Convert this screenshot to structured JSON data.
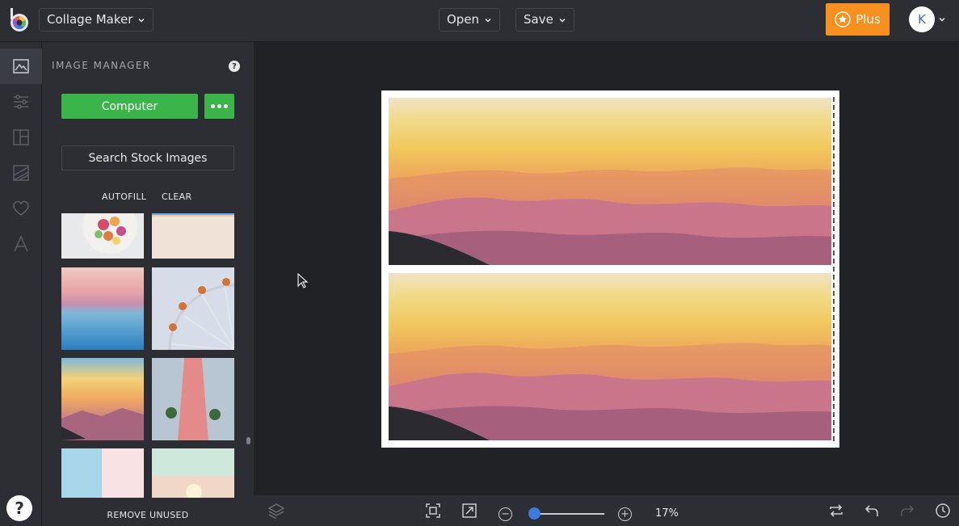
{
  "app": {
    "menu_label": "Collage Maker",
    "open_label": "Open",
    "save_label": "Save",
    "plus_label": "Plus",
    "avatar_initial": "K"
  },
  "colors": {
    "accent_green": "#3bb54a",
    "plus_orange": "#f7901e",
    "slider_blue": "#3b7ddd"
  },
  "rail": {
    "items": [
      {
        "icon": "image-icon",
        "active": true
      },
      {
        "icon": "adjust-sliders-icon"
      },
      {
        "icon": "layout-icon"
      },
      {
        "icon": "background-icon"
      },
      {
        "icon": "heart-icon"
      },
      {
        "icon": "text-icon"
      }
    ],
    "help_label": "?"
  },
  "image_manager": {
    "title": "IMAGE MANAGER",
    "help_label": "?",
    "computer_label": "Computer",
    "search_label": "Search Stock Images",
    "autofill_label": "AUTOFILL",
    "clear_label": "CLEAR",
    "remove_unused_label": "REMOVE UNUSED",
    "thumbnails": [
      "candy-jar",
      "beach-sand",
      "ocean-sunset",
      "ferris-wheel",
      "mountain-sunset",
      "building-facade",
      "pastel-wall",
      "lightbulb-hand"
    ]
  },
  "canvas": {
    "cells": [
      {
        "image": "mountain-sunset"
      },
      {
        "image": "mountain-sunset"
      }
    ]
  },
  "bottom_bar": {
    "zoom_minus": "−",
    "zoom_plus": "+",
    "zoom_level": 0.17,
    "zoom_label": "17%"
  }
}
